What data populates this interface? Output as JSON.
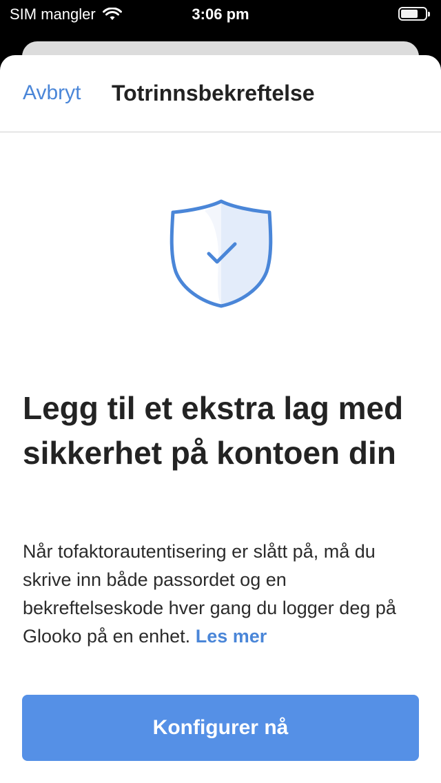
{
  "status_bar": {
    "carrier": "SIM mangler",
    "time": "3:06 pm",
    "wifi_icon": "wifi-icon",
    "battery_icon": "battery-icon"
  },
  "nav": {
    "cancel_label": "Avbryt",
    "title": "Totrinnsbekreftelse"
  },
  "hero": {
    "icon": "shield-check-icon",
    "accent_color": "#4a86d8"
  },
  "content": {
    "headline": "Legg til et ekstra lag med sikkerhet på kontoen din",
    "body": "Når tofaktorautentisering er slått på, må du skrive inn både passordet og en bekreftelseskode hver gang du logger deg på Glooko på en enhet.",
    "learn_more": "Les mer"
  },
  "actions": {
    "primary_label": "Konfigurer nå",
    "primary_color": "#5590e6"
  }
}
